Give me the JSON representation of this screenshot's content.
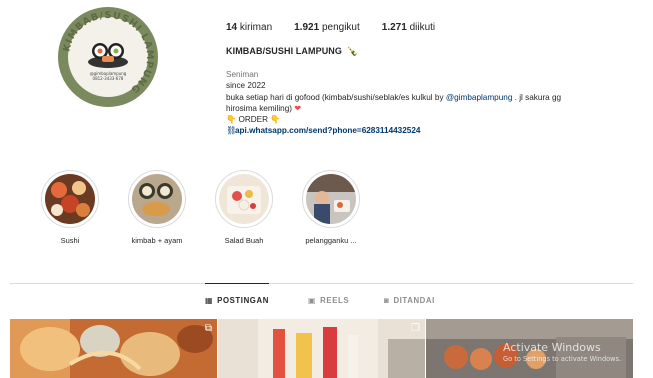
{
  "profile": {
    "logo_text": "KIMBAB/SUSHI LAMPUNG",
    "logo_handle": "@gimbaplampung",
    "logo_phone": "0812-3433-678",
    "stats": {
      "posts": "14",
      "posts_label": "kiriman",
      "followers": "1.921",
      "followers_label": "pengikut",
      "following": "1.271",
      "following_label": "diikuti"
    },
    "name": "KIMBAB/SUSHI LAMPUNG",
    "name_emoji": "🍾",
    "bio": {
      "category": "Seniman",
      "line1": "since 2022",
      "line2_prefix": "buka setiap hari di gofood (kimbab/sushi/seblak/es kulkul by ",
      "mention": "@gimbaplampung",
      "line2_suffix": " . jl sakura gg",
      "line3": "hirosima kemiling)",
      "line3_heart": "❤",
      "order_prefix": "👇",
      "order_text": " ORDER ",
      "order_suffix": "👇",
      "link_icon": "link-icon",
      "link": "api.whatsapp.com/send?phone=6283114432524"
    }
  },
  "highlights": [
    {
      "label": "Sushi"
    },
    {
      "label": "kimbab + ayam"
    },
    {
      "label": "Salad Buah"
    },
    {
      "label": "pelangganku ..."
    }
  ],
  "tabs": [
    {
      "label": "POSTINGAN",
      "icon": "grid-icon",
      "glyph": "▦",
      "active": true
    },
    {
      "label": "REELS",
      "icon": "reels-icon",
      "glyph": "▣",
      "active": false
    },
    {
      "label": "DITANDAI",
      "icon": "tagged-icon",
      "glyph": "◙",
      "active": false
    }
  ],
  "posts": [
    {
      "badge_icon": "reel-badge-icon",
      "badge_glyph": "⧉"
    },
    {
      "badge_icon": "multi-photo-icon",
      "badge_glyph": "❐"
    },
    {
      "badge_icon": "",
      "badge_glyph": ""
    }
  ],
  "watermark": {
    "title": "Activate Windows",
    "subtitle": "Go to Settings to activate Windows."
  },
  "colors": {
    "avatar_ring": "#7a8a5e",
    "link": "#00376b",
    "heart": "#ed4956",
    "muted": "#737373"
  }
}
